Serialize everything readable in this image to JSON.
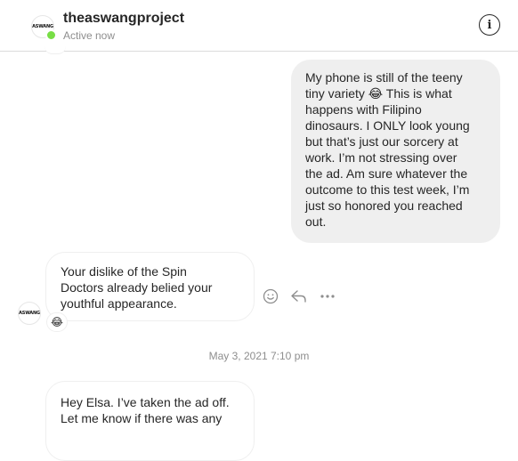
{
  "header": {
    "username": "theaswangproject",
    "status": "Active now",
    "avatar_text": "ASWANG"
  },
  "messages": [
    {
      "direction": "outgoing",
      "lines": [
        "My phone is still of the teeny",
        "tiny variety 😂 This is what",
        "happens with Filipino",
        "dinosaurs. I ONLY look young",
        "but that’s just our sorcery at",
        "work. I’m not stressing over",
        "the ad. Am sure whatever the",
        "outcome to this test week, I’m",
        "just so honored you reached",
        "out."
      ]
    },
    {
      "direction": "incoming",
      "lines": [
        "Your dislike of the Spin",
        "Doctors already belied your",
        "youthful appearance."
      ],
      "reaction": "😂"
    },
    {
      "direction": "incoming",
      "lines": [
        "Hey Elsa. I’ve taken the ad off.",
        "Let me know if there was any"
      ]
    }
  ],
  "date_separator": "May 3, 2021 7:10 pm",
  "icons": {
    "info": "info-icon",
    "react": "smiley-icon",
    "reply": "reply-arrow-icon",
    "more": "more-dots-icon"
  },
  "colors": {
    "online": "#78de45",
    "outgoing_bubble": "#efefef",
    "muted_text": "#8e8e8e"
  }
}
